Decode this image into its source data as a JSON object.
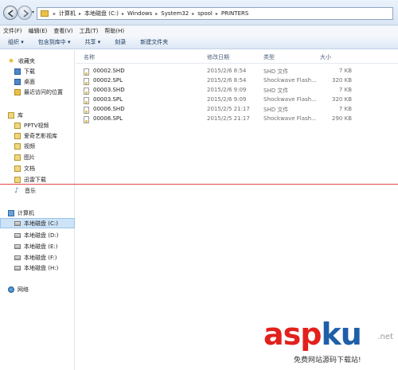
{
  "address": {
    "breadcrumbs": [
      "计算机",
      "本地磁盘 (C:)",
      "Windows",
      "System32",
      "spool",
      "PRINTERS"
    ]
  },
  "menubar": {
    "items": [
      "文件(F)",
      "编辑(E)",
      "查看(V)",
      "工具(T)",
      "帮助(H)"
    ]
  },
  "toolbar": {
    "items": [
      "组织 ▾",
      "包含到库中 ▾",
      "共享 ▾",
      "刻录",
      "新建文件夹"
    ]
  },
  "nav": {
    "favorites": {
      "label": "收藏夹",
      "items": [
        "下载",
        "桌面",
        "最近访问的位置"
      ]
    },
    "libraries": {
      "label": "库",
      "items": [
        "PPTV视频",
        "爱奇艺影视库",
        "视频",
        "图片",
        "文档",
        "迅雷下载",
        "音乐"
      ]
    },
    "computer": {
      "label": "计算机",
      "items": [
        "本地磁盘 (C:)",
        "本地磁盘 (D:)",
        "本地磁盘 (E:)",
        "本地磁盘 (F:)",
        "本地磁盘 (H:)"
      ],
      "selected_index": 0
    },
    "network": {
      "label": "网络"
    }
  },
  "columns": {
    "name": "名称",
    "date": "修改日期",
    "type": "类型",
    "size": "大小"
  },
  "files": [
    {
      "name": "00002.SHD",
      "date": "2015/2/6 8:54",
      "type": "SHD 文件",
      "size": "7 KB"
    },
    {
      "name": "00002.SPL",
      "date": "2015/2/6 8:54",
      "type": "Shockwave Flash...",
      "size": "320 KB"
    },
    {
      "name": "00003.SHD",
      "date": "2015/2/6 9:09",
      "type": "SHD 文件",
      "size": "7 KB"
    },
    {
      "name": "00003.SPL",
      "date": "2015/2/6 9:09",
      "type": "Shockwave Flash...",
      "size": "320 KB"
    },
    {
      "name": "00006.SHD",
      "date": "2015/2/5 21:17",
      "type": "SHD 文件",
      "size": "7 KB"
    },
    {
      "name": "00006.SPL",
      "date": "2015/2/5 21:17",
      "type": "Shockwave Flash...",
      "size": "290 KB"
    }
  ],
  "watermark": {
    "brand_a": "asp",
    "brand_b": "ku",
    "domain": ".net",
    "tagline": "免费网站源码下载站!"
  },
  "colors": {
    "selection": "#cde3f7",
    "annotation_line": "#e04a4a",
    "watermark_red": "#e2211c",
    "watermark_blue": "#1f5fa8"
  }
}
